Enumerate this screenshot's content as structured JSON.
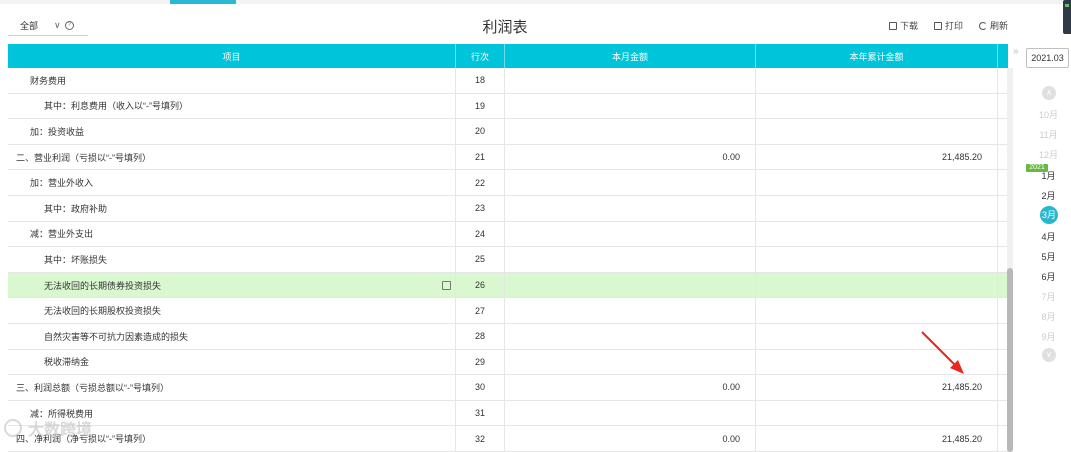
{
  "toolbar": {
    "filter_value": "全部",
    "title": "利润表",
    "download_label": "下载",
    "print_label": "打印",
    "refresh_label": "刷新"
  },
  "table": {
    "headers": [
      "项目",
      "行次",
      "本月金额",
      "本年累计金额"
    ],
    "rows": [
      {
        "item": "财务费用",
        "line": "18",
        "month": "",
        "ytd": ""
      },
      {
        "item": "其中：利息费用（收入以“-”号填列）",
        "line": "19",
        "month": "",
        "ytd": ""
      },
      {
        "item": "加：投资收益",
        "line": "20",
        "month": "",
        "ytd": ""
      },
      {
        "item": "二、营业利润（亏损以“-”号填列）",
        "line": "21",
        "month": "0.00",
        "ytd": "21,485.20"
      },
      {
        "item": "加：营业外收入",
        "line": "22",
        "month": "",
        "ytd": ""
      },
      {
        "item": "其中：政府补助",
        "line": "23",
        "month": "",
        "ytd": ""
      },
      {
        "item": "减：营业外支出",
        "line": "24",
        "month": "",
        "ytd": ""
      },
      {
        "item": "其中：坏账损失",
        "line": "25",
        "month": "",
        "ytd": ""
      },
      {
        "item": "无法收回的长期债券投资损失",
        "line": "26",
        "month": "",
        "ytd": ""
      },
      {
        "item": "无法收回的长期股权投资损失",
        "line": "27",
        "month": "",
        "ytd": ""
      },
      {
        "item": "自然灾害等不可抗力因素造成的损失",
        "line": "28",
        "month": "",
        "ytd": ""
      },
      {
        "item": "税收滞纳金",
        "line": "29",
        "month": "",
        "ytd": ""
      },
      {
        "item": "三、利润总额（亏损总额以“-”号填列）",
        "line": "30",
        "month": "0.00",
        "ytd": "21,485.20"
      },
      {
        "item": "减：所得税费用",
        "line": "31",
        "month": "",
        "ytd": ""
      },
      {
        "item": "四、净利润（净亏损以“-”号填列）",
        "line": "32",
        "month": "0.00",
        "ytd": "21,485.20"
      }
    ]
  },
  "period": {
    "current": "2021.03",
    "year_badge": "2021",
    "months": [
      "10月",
      "11月",
      "12月",
      "1月",
      "2月",
      "3月",
      "4月",
      "5月",
      "6月",
      "7月",
      "8月",
      "9月"
    ]
  },
  "colors": {
    "header_bg": "#00c5da",
    "highlight_row": "#d9f8cf",
    "current_month": "#26b8d0",
    "year_badge": "#6ab844",
    "annotation_arrow": "#e8281e"
  },
  "watermark": "大数跨境"
}
